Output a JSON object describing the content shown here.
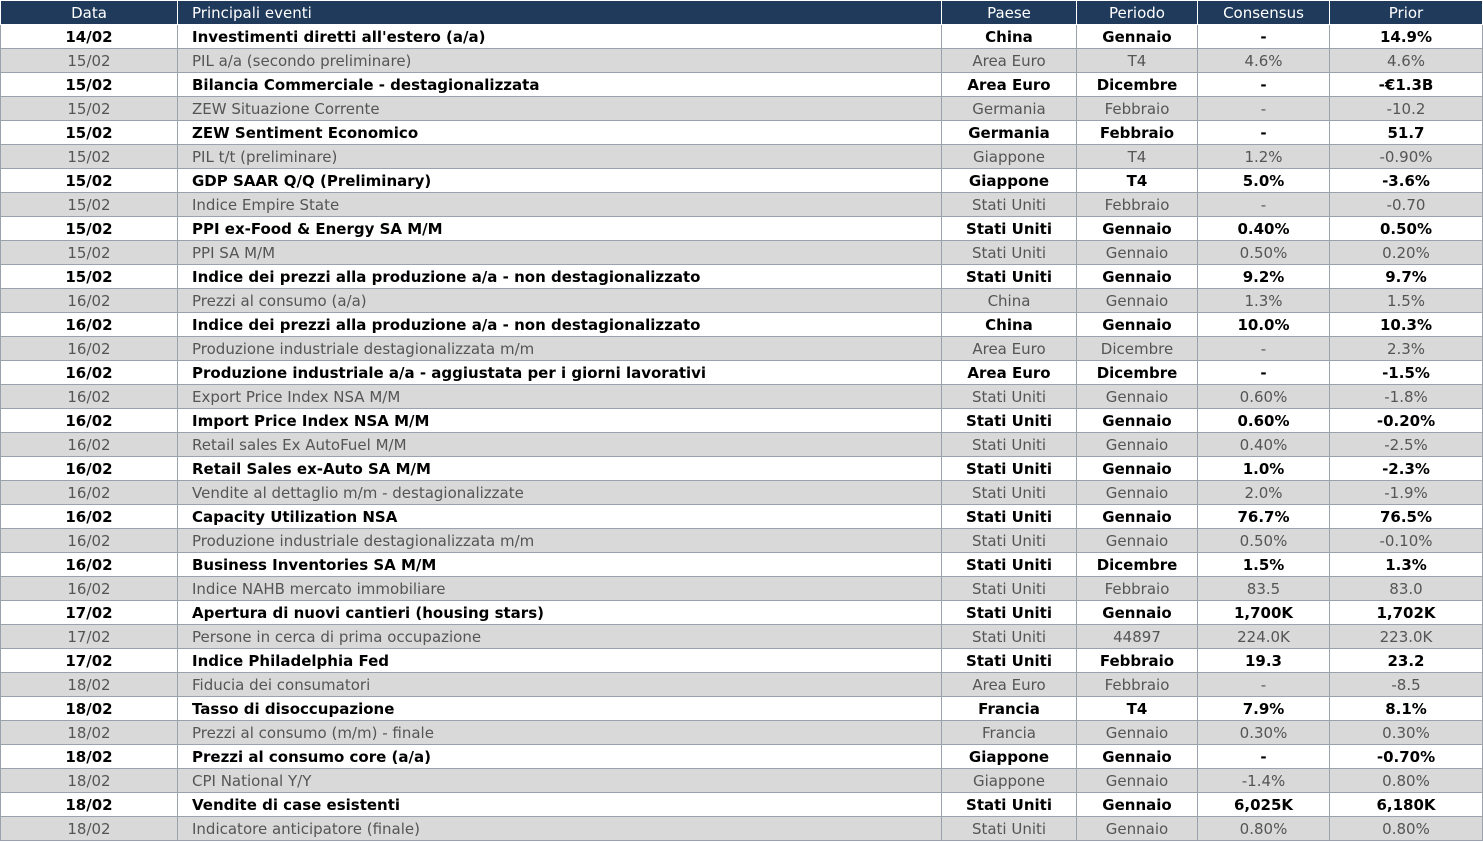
{
  "headers": [
    "Data",
    "Principali eventi",
    "Paese",
    "Periodo",
    "Consensus",
    "Prior"
  ],
  "rows": [
    {
      "style": "bold",
      "date": "14/02",
      "event": "Investimenti diretti all'estero (a/a)",
      "country": "China",
      "period": "Gennaio",
      "consensus": "-",
      "prior": "14.9%"
    },
    {
      "style": "normal",
      "date": "15/02",
      "event": "PIL a/a (secondo preliminare)",
      "country": "Area Euro",
      "period": "T4",
      "consensus": "4.6%",
      "prior": "4.6%"
    },
    {
      "style": "bold",
      "date": "15/02",
      "event": "Bilancia Commerciale - destagionalizzata",
      "country": "Area Euro",
      "period": "Dicembre",
      "consensus": "-",
      "prior": "-€1.3B"
    },
    {
      "style": "normal",
      "date": "15/02",
      "event": "ZEW Situazione Corrente",
      "country": "Germania",
      "period": "Febbraio",
      "consensus": "-",
      "prior": "-10.2"
    },
    {
      "style": "bold",
      "date": "15/02",
      "event": "ZEW Sentiment Economico",
      "country": "Germania",
      "period": "Febbraio",
      "consensus": "-",
      "prior": "51.7"
    },
    {
      "style": "normal",
      "date": "15/02",
      "event": "PIL t/t  (preliminare)",
      "country": "Giappone",
      "period": "T4",
      "consensus": "1.2%",
      "prior": "-0.90%"
    },
    {
      "style": "bold",
      "date": "15/02",
      "event": "GDP SAAR Q/Q (Preliminary)",
      "country": "Giappone",
      "period": "T4",
      "consensus": "5.0%",
      "prior": "-3.6%"
    },
    {
      "style": "normal",
      "date": "15/02",
      "event": "Indice Empire State",
      "country": "Stati Uniti",
      "period": "Febbraio",
      "consensus": "-",
      "prior": "-0.70"
    },
    {
      "style": "bold",
      "date": "15/02",
      "event": "PPI ex-Food & Energy SA M/M",
      "country": "Stati Uniti",
      "period": "Gennaio",
      "consensus": "0.40%",
      "prior": "0.50%"
    },
    {
      "style": "normal",
      "date": "15/02",
      "event": "PPI SA M/M",
      "country": "Stati Uniti",
      "period": "Gennaio",
      "consensus": "0.50%",
      "prior": "0.20%"
    },
    {
      "style": "bold",
      "date": "15/02",
      "event": "Indice dei prezzi alla produzione a/a -  non destagionalizzato",
      "country": "Stati Uniti",
      "period": "Gennaio",
      "consensus": "9.2%",
      "prior": "9.7%"
    },
    {
      "style": "normal",
      "date": "16/02",
      "event": "Prezzi al consumo   (a/a)",
      "country": "China",
      "period": "Gennaio",
      "consensus": "1.3%",
      "prior": "1.5%"
    },
    {
      "style": "bold",
      "date": "16/02",
      "event": "Indice dei prezzi alla produzione a/a -  non destagionalizzato",
      "country": "China",
      "period": "Gennaio",
      "consensus": "10.0%",
      "prior": "10.3%"
    },
    {
      "style": "normal",
      "date": "16/02",
      "event": "Produzione industriale destagionalizzata m/m",
      "country": "Area Euro",
      "period": "Dicembre",
      "consensus": "-",
      "prior": "2.3%"
    },
    {
      "style": "bold",
      "date": "16/02",
      "event": "Produzione industriale a/a - aggiustata per i giorni lavorativi",
      "country": "Area Euro",
      "period": "Dicembre",
      "consensus": "-",
      "prior": "-1.5%"
    },
    {
      "style": "normal",
      "date": "16/02",
      "event": "Export Price Index NSA M/M",
      "country": "Stati Uniti",
      "period": "Gennaio",
      "consensus": "0.60%",
      "prior": "-1.8%"
    },
    {
      "style": "bold",
      "date": "16/02",
      "event": "Import Price Index NSA M/M",
      "country": "Stati Uniti",
      "period": "Gennaio",
      "consensus": "0.60%",
      "prior": "-0.20%"
    },
    {
      "style": "normal",
      "date": "16/02",
      "event": "Retail sales Ex AutoFuel M/M",
      "country": "Stati Uniti",
      "period": "Gennaio",
      "consensus": "0.40%",
      "prior": "-2.5%"
    },
    {
      "style": "bold",
      "date": "16/02",
      "event": "Retail Sales ex-Auto SA M/M",
      "country": "Stati Uniti",
      "period": "Gennaio",
      "consensus": "1.0%",
      "prior": "-2.3%"
    },
    {
      "style": "normal",
      "date": "16/02",
      "event": "Vendite al dettaglio m/m - destagionalizzate",
      "country": "Stati Uniti",
      "period": "Gennaio",
      "consensus": "2.0%",
      "prior": "-1.9%"
    },
    {
      "style": "bold",
      "date": "16/02",
      "event": "Capacity Utilization NSA",
      "country": "Stati Uniti",
      "period": "Gennaio",
      "consensus": "76.7%",
      "prior": "76.5%"
    },
    {
      "style": "normal",
      "date": "16/02",
      "event": "Produzione industriale destagionalizzata m/m",
      "country": "Stati Uniti",
      "period": "Gennaio",
      "consensus": "0.50%",
      "prior": "-0.10%"
    },
    {
      "style": "bold",
      "date": "16/02",
      "event": "Business Inventories SA M/M",
      "country": "Stati Uniti",
      "period": "Dicembre",
      "consensus": "1.5%",
      "prior": "1.3%"
    },
    {
      "style": "normal",
      "date": "16/02",
      "event": "Indice NAHB mercato immobiliare",
      "country": "Stati Uniti",
      "period": "Febbraio",
      "consensus": "83.5",
      "prior": "83.0"
    },
    {
      "style": "bold",
      "date": "17/02",
      "event": "Apertura di nuovi cantieri (housing stars)",
      "country": "Stati Uniti",
      "period": "Gennaio",
      "consensus": "1,700K",
      "prior": "1,702K"
    },
    {
      "style": "normal",
      "date": "17/02",
      "event": "Persone in cerca di prima occupazione",
      "country": "Stati Uniti",
      "period": "44897",
      "consensus": "224.0K",
      "prior": "223.0K"
    },
    {
      "style": "bold",
      "date": "17/02",
      "event": "Indice Philadelphia Fed",
      "country": "Stati Uniti",
      "period": "Febbraio",
      "consensus": "19.3",
      "prior": "23.2"
    },
    {
      "style": "normal",
      "date": "18/02",
      "event": "Fiducia dei consumatori",
      "country": "Area Euro",
      "period": "Febbraio",
      "consensus": "-",
      "prior": "-8.5"
    },
    {
      "style": "bold",
      "date": "18/02",
      "event": "Tasso di disoccupazione",
      "country": "Francia",
      "period": "T4",
      "consensus": "7.9%",
      "prior": "8.1%"
    },
    {
      "style": "normal",
      "date": "18/02",
      "event": "Prezzi al consumo (m/m) - finale",
      "country": "Francia",
      "period": "Gennaio",
      "consensus": "0.30%",
      "prior": "0.30%"
    },
    {
      "style": "bold",
      "date": "18/02",
      "event": "Prezzi al consumo core (a/a)",
      "country": "Giappone",
      "period": "Gennaio",
      "consensus": "-",
      "prior": "-0.70%"
    },
    {
      "style": "normal",
      "date": "18/02",
      "event": "CPI National Y/Y",
      "country": "Giappone",
      "period": "Gennaio",
      "consensus": "-1.4%",
      "prior": "0.80%"
    },
    {
      "style": "bold",
      "date": "18/02",
      "event": "Vendite di case esistenti",
      "country": "Stati Uniti",
      "period": "Gennaio",
      "consensus": "6,025K",
      "prior": "6,180K"
    },
    {
      "style": "normal",
      "date": "18/02",
      "event": "Indicatore anticipatore (finale)",
      "country": "Stati Uniti",
      "period": "Gennaio",
      "consensus": "0.80%",
      "prior": "0.80%"
    }
  ]
}
